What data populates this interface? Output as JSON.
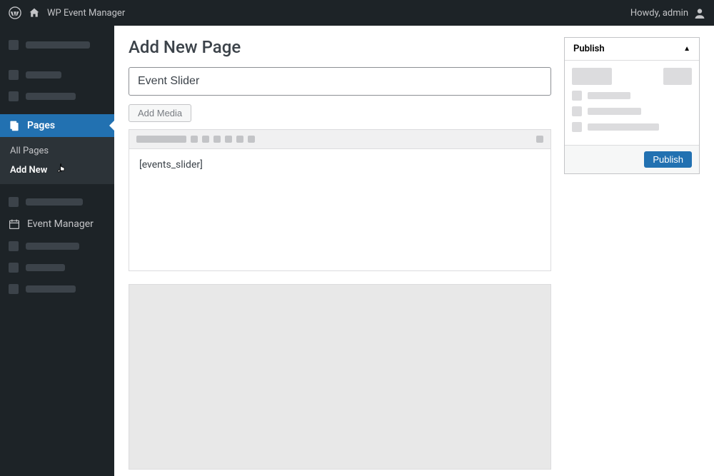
{
  "topbar": {
    "site_name": "WP Event Manager",
    "greeting": "Howdy, admin"
  },
  "sidebar": {
    "pages_label": "Pages",
    "submenu": {
      "all": "All Pages",
      "add_new": "Add New"
    },
    "event_manager_label": "Event Manager"
  },
  "page": {
    "heading": "Add New Page",
    "title_value": "Event Slider",
    "add_media_label": "Add Media",
    "editor_content": "[events_slider]"
  },
  "publish": {
    "header": "Publish",
    "button": "Publish"
  }
}
